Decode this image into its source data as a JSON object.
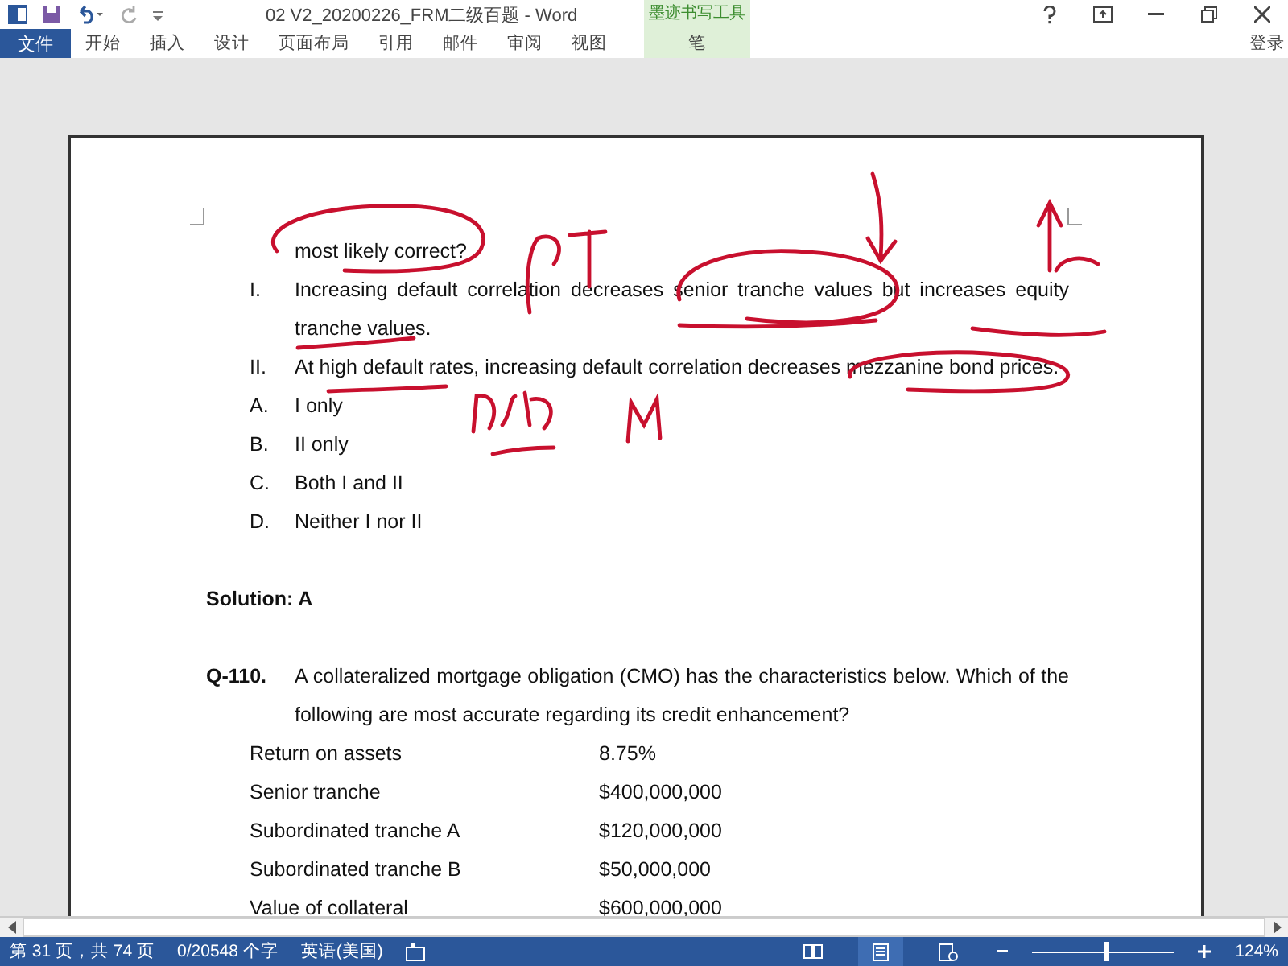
{
  "window": {
    "title": "02 V2_20200226_FRM二级百题 - Word"
  },
  "ribbon": {
    "file_tab": "文件",
    "tabs": [
      {
        "label": "开始",
        "selected": false
      },
      {
        "label": "插入",
        "selected": false
      },
      {
        "label": "设计",
        "selected": false
      },
      {
        "label": "页面布局",
        "selected": false
      },
      {
        "label": "引用",
        "selected": false
      },
      {
        "label": "邮件",
        "selected": false
      },
      {
        "label": "审阅",
        "selected": false
      },
      {
        "label": "视图",
        "selected": false
      }
    ],
    "contextual_group": {
      "title": "墨迹书写工具",
      "tabs": [
        {
          "label": "笔",
          "selected": false
        }
      ]
    },
    "sign_in": "登录"
  },
  "document": {
    "blocks": [
      {
        "kind": "stem_tail",
        "text": "most likely correct?"
      },
      {
        "kind": "item",
        "label": "I.",
        "text": "Increasing default correlation decreases senior tranche values but increases equity tranche values."
      },
      {
        "kind": "item",
        "label": "II.",
        "text": "At high default rates, increasing default correlation decreases mezzanine bond prices."
      },
      {
        "kind": "item",
        "label": "A.",
        "text": "I only"
      },
      {
        "kind": "item",
        "label": "B.",
        "text": "II only"
      },
      {
        "kind": "item",
        "label": "C.",
        "text": "Both I and II"
      },
      {
        "kind": "item",
        "label": "D.",
        "text": "Neither I nor II"
      },
      {
        "kind": "solution",
        "text": "Solution: A"
      },
      {
        "kind": "question",
        "label": "Q-110.",
        "text": "A collateralized mortgage obligation (CMO) has the characteristics below. Which of the following are most accurate regarding its credit enhancement?"
      },
      {
        "kind": "table_row",
        "label": "Return on assets",
        "value": "8.75%"
      },
      {
        "kind": "table_row",
        "label": "Senior tranche",
        "value": "$400,000,000"
      },
      {
        "kind": "table_row",
        "label": "Subordinated tranche A",
        "value": "$120,000,000"
      },
      {
        "kind": "table_row",
        "label": "Subordinated tranche B",
        "value": "$50,000,000"
      },
      {
        "kind": "table_row",
        "label": "Value of collateral",
        "value": "$600,000,000"
      }
    ]
  },
  "status_bar": {
    "page": "第 31 页，共 74 页",
    "words": "0/20548 个字",
    "language": "英语(美国)",
    "zoom": {
      "level": 0.52,
      "reading": "124%"
    }
  }
}
